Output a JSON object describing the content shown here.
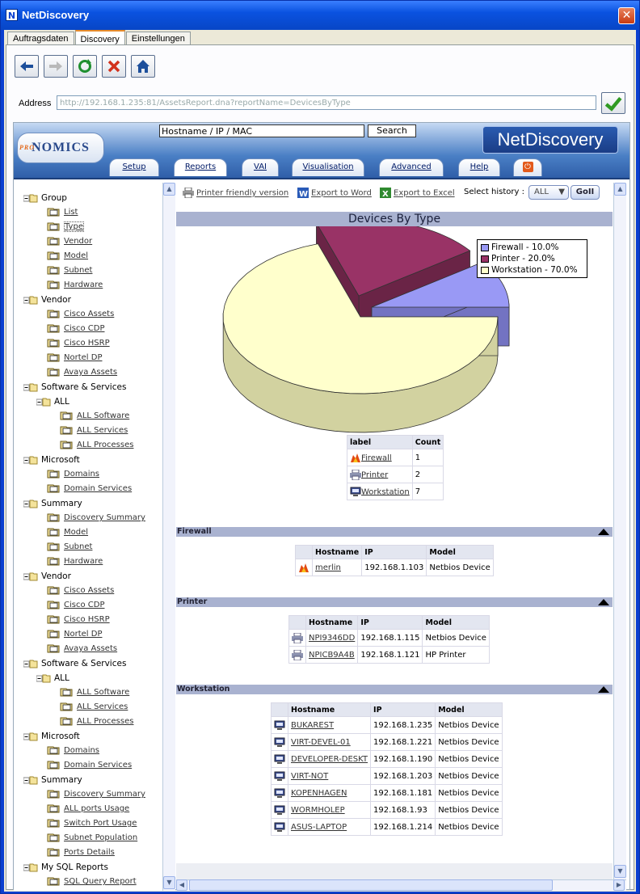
{
  "window": {
    "title": "NetDiscovery",
    "close_glyph": "✕"
  },
  "tabs": [
    "Auftragsdaten",
    "Discovery",
    "Einstellungen"
  ],
  "address": {
    "label": "Address",
    "value": "http://192.168.1.235:81/AssetsReport.dna?reportName=DevicesByType"
  },
  "banner": {
    "logo": "NOMICS",
    "logo_pro": "PRO",
    "search_placeholder": "Hostname / IP / MAC",
    "search_button": "Search",
    "brand": "NetDiscovery",
    "nav": [
      "Setup",
      "Reports",
      "VAI",
      "Visualisation",
      "Advanced",
      "Help"
    ]
  },
  "tree": [
    {
      "label": "Group",
      "group": true
    },
    {
      "label": "List"
    },
    {
      "label": "Type",
      "selected": true
    },
    {
      "label": "Vendor"
    },
    {
      "label": "Model"
    },
    {
      "label": "Subnet"
    },
    {
      "label": "Hardware"
    },
    {
      "label": "Vendor",
      "group": true
    },
    {
      "label": "Cisco Assets"
    },
    {
      "label": "Cisco CDP"
    },
    {
      "label": "Cisco HSRP"
    },
    {
      "label": "Nortel DP"
    },
    {
      "label": "Avaya Assets"
    },
    {
      "label": "Software & Services",
      "group": true
    },
    {
      "label": "ALL",
      "group": true,
      "level": 1
    },
    {
      "label": "ALL Software",
      "level": 2
    },
    {
      "label": "ALL Services",
      "level": 2
    },
    {
      "label": "ALL Processes",
      "level": 2
    },
    {
      "label": "Microsoft",
      "group": true
    },
    {
      "label": "Domains"
    },
    {
      "label": "Domain Services"
    },
    {
      "label": "Summary",
      "group": true
    },
    {
      "label": "Discovery Summary"
    },
    {
      "label": "Model"
    },
    {
      "label": "Subnet"
    },
    {
      "label": "Hardware"
    },
    {
      "label": "Vendor",
      "group": true
    },
    {
      "label": "Cisco Assets"
    },
    {
      "label": "Cisco CDP"
    },
    {
      "label": "Cisco HSRP"
    },
    {
      "label": "Nortel DP"
    },
    {
      "label": "Avaya Assets"
    },
    {
      "label": "Software & Services",
      "group": true
    },
    {
      "label": "ALL",
      "group": true,
      "level": 1
    },
    {
      "label": "ALL Software",
      "level": 2
    },
    {
      "label": "ALL Services",
      "level": 2
    },
    {
      "label": "ALL Processes",
      "level": 2
    },
    {
      "label": "Microsoft",
      "group": true
    },
    {
      "label": "Domains"
    },
    {
      "label": "Domain Services"
    },
    {
      "label": "Summary",
      "group": true
    },
    {
      "label": "Discovery Summary"
    },
    {
      "label": "ALL ports Usage"
    },
    {
      "label": "Switch Port Usage"
    },
    {
      "label": "Subnet Population"
    },
    {
      "label": "Ports Details"
    },
    {
      "label": "My SQL Reports",
      "group": true
    },
    {
      "label": "SQL Query Report"
    }
  ],
  "report_toolbar": {
    "print": "Printer friendly version",
    "word": "Export to Word",
    "excel": "Export to Excel",
    "history_label": "Select history :",
    "history_value": "ALL",
    "go": "GoII"
  },
  "report": {
    "title": "Devices By Type",
    "summary_headers": [
      "label",
      "Count"
    ],
    "summary_rows": [
      {
        "label": "Firewall",
        "count": "1",
        "icon": "firewall"
      },
      {
        "label": "Printer",
        "count": "2",
        "icon": "printer"
      },
      {
        "label": "Workstation",
        "count": "7",
        "icon": "workstation"
      }
    ],
    "sections": [
      {
        "name": "Firewall",
        "icon": "firewall",
        "headers": [
          "Hostname",
          "IP",
          "Model"
        ],
        "rows": [
          [
            "merlin",
            "192.168.1.103",
            "Netbios Device"
          ]
        ]
      },
      {
        "name": "Printer",
        "icon": "printer",
        "headers": [
          "Hostname",
          "IP",
          "Model"
        ],
        "rows": [
          [
            "NPI9346DD",
            "192.168.1.115",
            "Netbios Device"
          ],
          [
            "NPICB9A4B",
            "192.168.1.121",
            "HP Printer"
          ]
        ]
      },
      {
        "name": "Workstation",
        "icon": "workstation",
        "headers": [
          "Hostname",
          "IP",
          "Model"
        ],
        "rows": [
          [
            "BUKAREST",
            "192.168.1.235",
            "Netbios Device"
          ],
          [
            "VIRT-DEVEL-01",
            "192.168.1.221",
            "Netbios Device"
          ],
          [
            "DEVELOPER-DESKT",
            "192.168.1.190",
            "Netbios Device"
          ],
          [
            "VIRT-NOT",
            "192.168.1.203",
            "Netbios Device"
          ],
          [
            "KOPENHAGEN",
            "192.168.1.181",
            "Netbios Device"
          ],
          [
            "WORMHOLEP",
            "192.168.1.93",
            "Netbios Device"
          ],
          [
            "ASUS-LAPTOP",
            "192.168.1.214",
            "Netbios Device"
          ]
        ]
      }
    ]
  },
  "chart_data": {
    "type": "pie",
    "title": "Devices By Type",
    "categories": [
      "Firewall",
      "Printer",
      "Workstation"
    ],
    "values": [
      10.0,
      20.0,
      70.0
    ],
    "legend_labels": [
      "Firewall - 10.0%",
      "Printer - 20.0%",
      "Workstation - 70.0%"
    ],
    "colors": [
      "#9999f5",
      "#993366",
      "#ffffcc"
    ],
    "legend": "top-right"
  }
}
